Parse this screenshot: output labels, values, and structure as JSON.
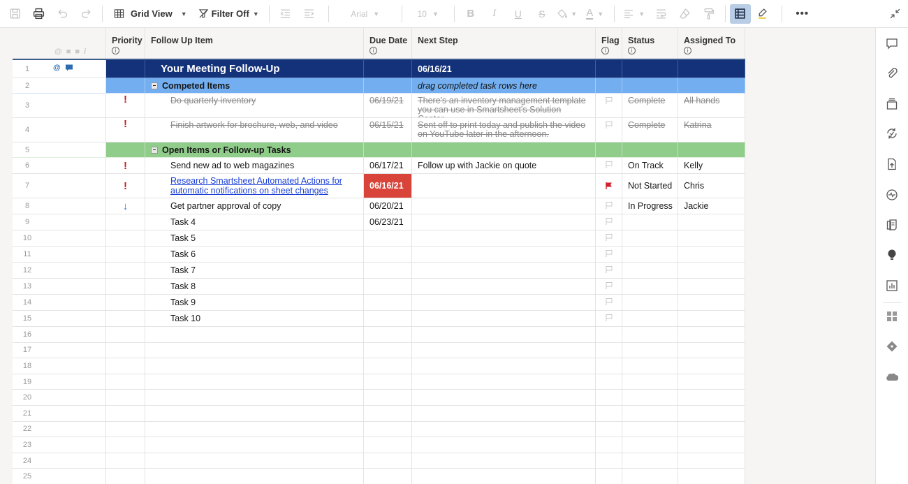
{
  "toolbar": {
    "view_label": "Grid View",
    "filter_label": "Filter Off",
    "font_family": "Arial",
    "font_size": "10"
  },
  "columns": [
    {
      "key": "priority",
      "label": "Priority",
      "info": true
    },
    {
      "key": "item",
      "label": "Follow Up Item",
      "info": false
    },
    {
      "key": "due",
      "label": "Due Date",
      "info": true
    },
    {
      "key": "next",
      "label": "Next Step",
      "info": false
    },
    {
      "key": "flag",
      "label": "Flag",
      "info": true
    },
    {
      "key": "status",
      "label": "Status",
      "info": true
    },
    {
      "key": "assigned",
      "label": "Assigned To",
      "info": true
    }
  ],
  "info_glyph": "i",
  "rows": [
    {
      "num": "1",
      "type": "title",
      "item": "Your Meeting Follow-Up",
      "next": "06/16/21",
      "has_attachment": true,
      "has_comment": true
    },
    {
      "num": "2",
      "type": "group-done",
      "item": "Competed Items",
      "next": "drag completed task rows here"
    },
    {
      "num": "3",
      "type": "done",
      "priority": "high",
      "item": "Do quarterly inventory",
      "due": "06/19/21",
      "next": "There's an inventory management template you can use in Smartsheet's Solution Center.",
      "flag": false,
      "status": "Complete",
      "assigned": "All hands"
    },
    {
      "num": "4",
      "type": "done",
      "priority": "high",
      "item": "Finish artwork for brochure, web, and video",
      "due": "06/15/21",
      "next": "Sent off to print today and publish the video on YouTube later in the afternoon.",
      "flag": false,
      "status": "Complete",
      "assigned": "Katrina"
    },
    {
      "num": "5",
      "type": "group-open",
      "item": "Open Items or Follow-up Tasks"
    },
    {
      "num": "6",
      "type": "task",
      "priority": "high",
      "item": "Send new ad to web magazines",
      "due": "06/17/21",
      "next": "Follow up with Jackie on quote",
      "flag": false,
      "status": "On Track",
      "assigned": "Kelly"
    },
    {
      "num": "7",
      "type": "task",
      "priority": "high",
      "item": "Research Smartsheet Automated Actions for automatic notifications on sheet changes",
      "link": true,
      "due": "06/16/21",
      "due_overdue": true,
      "next": "",
      "flag": true,
      "status": "Not Started",
      "assigned": "Chris"
    },
    {
      "num": "8",
      "type": "task",
      "priority": "low",
      "item": "Get partner approval of copy",
      "due": "06/20/21",
      "next": "",
      "flag": false,
      "status": "In Progress",
      "assigned": "Jackie"
    },
    {
      "num": "9",
      "type": "task",
      "item": "Task 4",
      "due": "06/23/21",
      "flag": false
    },
    {
      "num": "10",
      "type": "task",
      "item": "Task 5",
      "flag": false
    },
    {
      "num": "11",
      "type": "task",
      "item": "Task 6",
      "flag": false
    },
    {
      "num": "12",
      "type": "task",
      "item": "Task 7",
      "flag": false
    },
    {
      "num": "13",
      "type": "task",
      "item": "Task 8",
      "flag": false
    },
    {
      "num": "14",
      "type": "task",
      "item": "Task 9",
      "flag": false
    },
    {
      "num": "15",
      "type": "task",
      "item": "Task 10",
      "flag": false
    },
    {
      "num": "16",
      "type": "empty"
    },
    {
      "num": "17",
      "type": "empty"
    },
    {
      "num": "18",
      "type": "empty"
    },
    {
      "num": "19",
      "type": "empty"
    },
    {
      "num": "20",
      "type": "empty"
    },
    {
      "num": "21",
      "type": "empty"
    },
    {
      "num": "22",
      "type": "empty"
    },
    {
      "num": "23",
      "type": "empty"
    },
    {
      "num": "24",
      "type": "empty"
    },
    {
      "num": "25",
      "type": "empty"
    }
  ],
  "priority_glyphs": {
    "high": "!",
    "low": "↓"
  },
  "colors": {
    "title_row": "#14327a",
    "done_group_row": "#72aef0",
    "open_group_row": "#90cc8a",
    "overdue": "#d8443a",
    "flag_on": "#d0202a",
    "link": "#1a3fd6",
    "active_tool": "#b9cde6"
  },
  "right_rail": [
    "conversations-icon",
    "attachments-icon",
    "proofs-icon",
    "update-requests-icon",
    "publish-icon",
    "activity-log-icon",
    "summary-icon",
    "ideas-icon",
    "reports-icon",
    "apps-icon",
    "connectors-icon",
    "salesforce-icon"
  ]
}
